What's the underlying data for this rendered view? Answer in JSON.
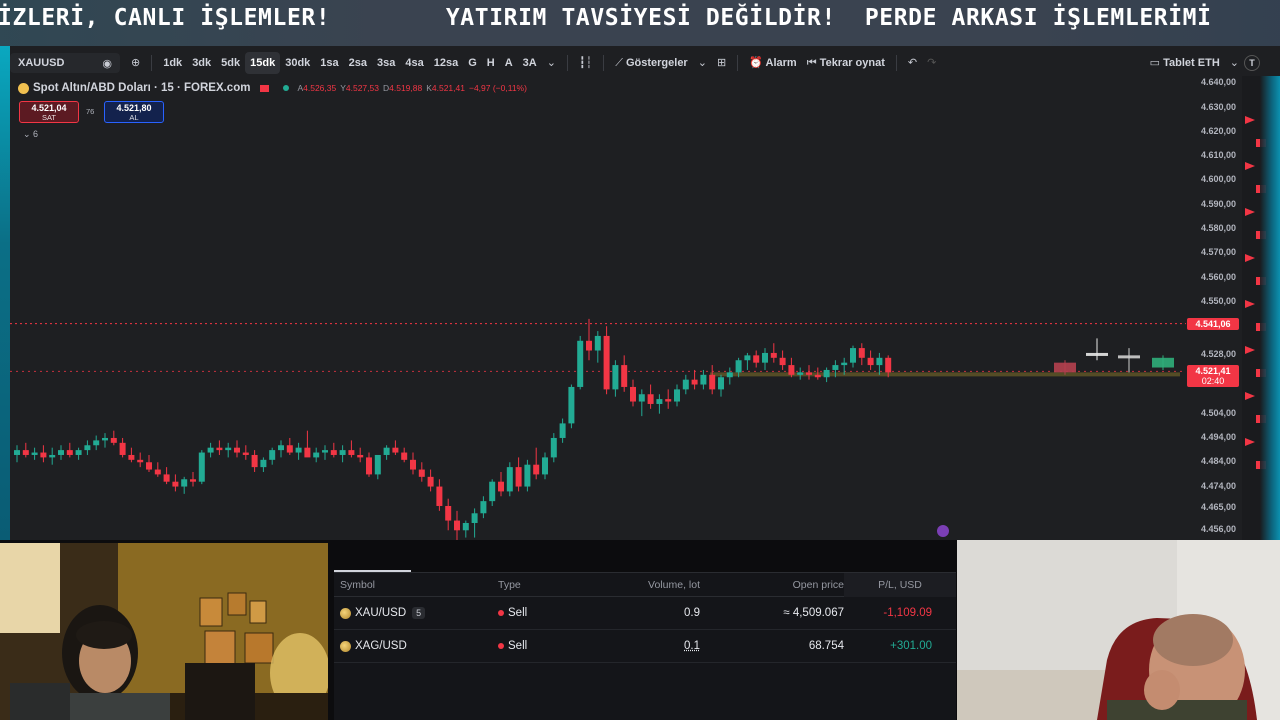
{
  "ticker": {
    "text": "İZLERİ, CANLI İŞLEMLER!        YATIRIM TAVSİYESİ DEĞİLDİR!  PERDE ARKASI İŞLEMLERİMİ"
  },
  "toolbar": {
    "symbol": "XAUUSD",
    "intervals": [
      "1dk",
      "3dk",
      "5dk",
      "15dk",
      "30dk",
      "1sa",
      "2sa",
      "3sa",
      "4sa",
      "12sa",
      "G",
      "H",
      "A",
      "3A"
    ],
    "active_interval": "15dk",
    "indicators": "Göstergeler",
    "alarm": "Alarm",
    "replay": "Tekrar oynat",
    "layout": "Tablet ETH",
    "layout_short": "T"
  },
  "legend": {
    "title": "Spot Altın/ABD Doları · 15 · FOREX.com",
    "ohlc": [
      {
        "k": "A",
        "v": "4.526,35"
      },
      {
        "k": "Y",
        "v": "4.527,53"
      },
      {
        "k": "D",
        "v": "4.519,88"
      },
      {
        "k": "K",
        "v": "4.521,41"
      }
    ],
    "change": "−4,97 (−0,11%)",
    "sell_price": "4.521,04",
    "sell_label": "SAT",
    "buy_price": "4.521,80",
    "buy_label": "AL",
    "spread": "76",
    "collapsed_count": "6"
  },
  "price_axis": {
    "labels": [
      "4.640,00",
      "4.630,00",
      "4.620,00",
      "4.610,00",
      "4.600,00",
      "4.590,00",
      "4.580,00",
      "4.570,00",
      "4.560,00",
      "4.550,00",
      "4.528,00",
      "4.504,00",
      "4.494,00",
      "4.484,00",
      "4.474,00",
      "4.465,00",
      "4.456,00"
    ],
    "high_flag": "4.541,06",
    "last_flag": "4.521,41",
    "countdown": "02:40"
  },
  "chart_data": {
    "type": "candlestick",
    "interval": "15dk",
    "y_range": [
      4452,
      4643
    ],
    "candles": [
      [
        4487,
        4491,
        4484,
        4489
      ],
      [
        4489,
        4492,
        4486,
        4487
      ],
      [
        4487,
        4490,
        4485,
        4488
      ],
      [
        4488,
        4491,
        4484,
        4486
      ],
      [
        4486,
        4490,
        4483,
        4487
      ],
      [
        4487,
        4491,
        4485,
        4489
      ],
      [
        4489,
        4492,
        4486,
        4487
      ],
      [
        4487,
        4490,
        4485,
        4489
      ],
      [
        4489,
        4493,
        4487,
        4491
      ],
      [
        4491,
        4495,
        4489,
        4493
      ],
      [
        4493,
        4496,
        4490,
        4494
      ],
      [
        4494,
        4497,
        4491,
        4492
      ],
      [
        4492,
        4494,
        4486,
        4487
      ],
      [
        4487,
        4490,
        4484,
        4485
      ],
      [
        4485,
        4488,
        4482,
        4484
      ],
      [
        4484,
        4487,
        4480,
        4481
      ],
      [
        4481,
        4484,
        4478,
        4479
      ],
      [
        4479,
        4482,
        4475,
        4476
      ],
      [
        4476,
        4479,
        4472,
        4474
      ],
      [
        4474,
        4478,
        4471,
        4477
      ],
      [
        4477,
        4480,
        4474,
        4476
      ],
      [
        4476,
        4489,
        4475,
        4488
      ],
      [
        4488,
        4492,
        4486,
        4490
      ],
      [
        4490,
        4493,
        4487,
        4489
      ],
      [
        4489,
        4492,
        4486,
        4490
      ],
      [
        4490,
        4493,
        4486,
        4488
      ],
      [
        4488,
        4491,
        4485,
        4487
      ],
      [
        4487,
        4489,
        4480,
        4482
      ],
      [
        4482,
        4486,
        4480,
        4485
      ],
      [
        4485,
        4490,
        4483,
        4489
      ],
      [
        4489,
        4493,
        4486,
        4491
      ],
      [
        4491,
        4494,
        4487,
        4488
      ],
      [
        4488,
        4492,
        4485,
        4490
      ],
      [
        4490,
        4497,
        4488,
        4486
      ],
      [
        4486,
        4490,
        4484,
        4488
      ],
      [
        4488,
        4491,
        4485,
        4489
      ],
      [
        4489,
        4492,
        4486,
        4487
      ],
      [
        4487,
        4491,
        4484,
        4489
      ],
      [
        4489,
        4493,
        4486,
        4487
      ],
      [
        4487,
        4490,
        4484,
        4486
      ],
      [
        4486,
        4488,
        4478,
        4479
      ],
      [
        4479,
        4484,
        4477,
        4487
      ],
      [
        4487,
        4491,
        4485,
        4490
      ],
      [
        4490,
        4493,
        4487,
        4488
      ],
      [
        4488,
        4490,
        4484,
        4485
      ],
      [
        4485,
        4488,
        4479,
        4481
      ],
      [
        4481,
        4484,
        4476,
        4478
      ],
      [
        4478,
        4481,
        4472,
        4474
      ],
      [
        4474,
        4477,
        4464,
        4466
      ],
      [
        4466,
        4469,
        4456,
        4460
      ],
      [
        4460,
        4464,
        4452,
        4456
      ],
      [
        4456,
        4460,
        4453,
        4459
      ],
      [
        4459,
        4465,
        4453,
        4463
      ],
      [
        4463,
        4470,
        4461,
        4468
      ],
      [
        4468,
        4477,
        4466,
        4476
      ],
      [
        4476,
        4480,
        4470,
        4472
      ],
      [
        4472,
        4484,
        4470,
        4482
      ],
      [
        4482,
        4486,
        4472,
        4474
      ],
      [
        4474,
        4485,
        4472,
        4483
      ],
      [
        4483,
        4490,
        4477,
        4479
      ],
      [
        4479,
        4488,
        4477,
        4486
      ],
      [
        4486,
        4496,
        4484,
        4494
      ],
      [
        4494,
        4502,
        4492,
        4500
      ],
      [
        4500,
        4516,
        4498,
        4515
      ],
      [
        4515,
        4536,
        4514,
        4534
      ],
      [
        4534,
        4543,
        4526,
        4530
      ],
      [
        4530,
        4538,
        4525,
        4536
      ],
      [
        4536,
        4540,
        4512,
        4514
      ],
      [
        4514,
        4526,
        4511,
        4524
      ],
      [
        4524,
        4528,
        4513,
        4515
      ],
      [
        4515,
        4518,
        4507,
        4509
      ],
      [
        4509,
        4514,
        4503,
        4512
      ],
      [
        4512,
        4516,
        4506,
        4508
      ],
      [
        4508,
        4512,
        4504,
        4510
      ],
      [
        4510,
        4514,
        4506,
        4509
      ],
      [
        4509,
        4516,
        4507,
        4514
      ],
      [
        4514,
        4520,
        4512,
        4518
      ],
      [
        4518,
        4522,
        4514,
        4516
      ],
      [
        4516,
        4522,
        4514,
        4520
      ],
      [
        4520,
        4524,
        4512,
        4514
      ],
      [
        4514,
        4520,
        4511,
        4519
      ],
      [
        4519,
        4523,
        4516,
        4521
      ],
      [
        4521,
        4527,
        4519,
        4526
      ],
      [
        4526,
        4529,
        4522,
        4528
      ],
      [
        4528,
        4530,
        4523,
        4525
      ],
      [
        4525,
        4531,
        4522,
        4529
      ],
      [
        4529,
        4533,
        4525,
        4527
      ],
      [
        4527,
        4530,
        4522,
        4524
      ],
      [
        4524,
        4527,
        4519,
        4520
      ],
      [
        4520,
        4523,
        4518,
        4521
      ],
      [
        4521,
        4524,
        4518,
        4520
      ],
      [
        4520,
        4523,
        4518,
        4519
      ],
      [
        4519,
        4523,
        4517,
        4522
      ],
      [
        4522,
        4526,
        4519,
        4524
      ],
      [
        4524,
        4527,
        4520,
        4525
      ],
      [
        4525,
        4532,
        4523,
        4531
      ],
      [
        4531,
        4533,
        4524,
        4527
      ],
      [
        4527,
        4530,
        4522,
        4524
      ],
      [
        4524,
        4529,
        4520,
        4527
      ],
      [
        4527,
        4528,
        4519,
        4521
      ]
    ],
    "future_candles": [
      [
        4521,
        4526,
        4520,
        4525
      ],
      [
        4528,
        4535,
        4526,
        4529
      ],
      [
        4528,
        4531,
        4521,
        4528
      ],
      [
        4523,
        4528,
        4522,
        4527
      ]
    ],
    "high_line": 4541.06,
    "last_line": 4521.41,
    "low_line": 4456
  },
  "positions": {
    "columns": [
      "Symbol",
      "Type",
      "Volume, lot",
      "Open price",
      "P/L, USD"
    ],
    "rows": [
      {
        "symbol": "XAU/USD",
        "badge": "5",
        "type": "Sell",
        "volume": "0.9",
        "open": "≈ 4,509.067",
        "pl": "-1,109.09",
        "pl_sign": "neg"
      },
      {
        "symbol": "XAG/USD",
        "badge": "",
        "type": "Sell",
        "volume": "0.1",
        "open": "68.754",
        "pl": "+301.00",
        "pl_sign": "pos"
      }
    ]
  },
  "colors": {
    "up": "#22ab94",
    "down": "#f23645",
    "background": "#1e1f22"
  },
  "icons": [
    "eye-icon",
    "plus-circle-icon",
    "candle-type-icon",
    "indicators-icon",
    "layout-grid-icon",
    "alarm-clock-icon",
    "replay-icon",
    "undo-icon",
    "redo-icon",
    "window-icon"
  ]
}
